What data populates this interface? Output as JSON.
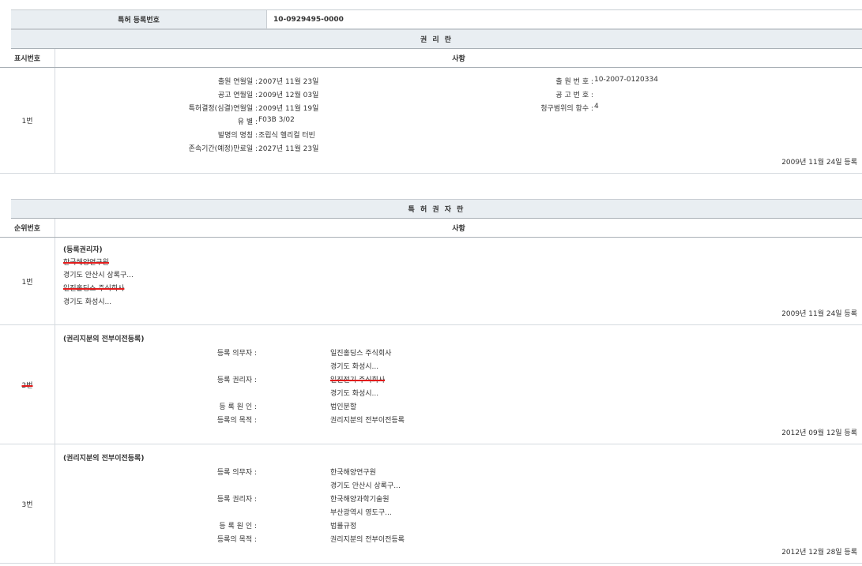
{
  "registration": {
    "label": "특허 등록번호",
    "value": "10-0929495-0000"
  },
  "rights_section": {
    "title": "권 리 란",
    "col_no": "표시번호",
    "col_content": "사항",
    "rows": [
      {
        "no": "1번",
        "left_fields": [
          {
            "label": "출원 연월일",
            "value": "2007년 11월 23일"
          },
          {
            "label": "공고 연월일",
            "value": "2009년 12월 03일"
          },
          {
            "label": "특허결정(심결)연월일",
            "value": "2009년 11월 19일"
          },
          {
            "label": "유 별",
            "value": "F03B 3/02"
          },
          {
            "label": "발명의 명칭",
            "value": "조립식 헬리컬 터빈"
          },
          {
            "label": "존속기간(예정)만료일",
            "value": "2027년 11월 23일"
          }
        ],
        "right_fields": [
          {
            "label": "출 원 번 호",
            "value": "10-2007-0120334"
          },
          {
            "label": "공 고 번 호",
            "value": ""
          },
          {
            "label": "청구범위의 항수",
            "value": "4"
          }
        ],
        "date": "2009년 11월 24일 등록"
      }
    ]
  },
  "holders_section": {
    "title": "특 허 권 자 란",
    "col_no": "순위번호",
    "col_content": "사항",
    "row1": {
      "no": "1번",
      "title": "(등록권리자)",
      "lines": [
        "한국해양연구원",
        "경기도 안산시 상록구...",
        "일진홀딩스 주식회사",
        "경기도 화성시..."
      ],
      "date": "2009년 11월 24일 등록"
    },
    "row2": {
      "no": "2번",
      "title": "(권리지분의 전부이전등록)",
      "fields": [
        {
          "label": "등록 의무자",
          "value": "일진홀딩스 주식회사"
        },
        {
          "label": "",
          "value": "경기도 화성시..."
        },
        {
          "label": "등록 권리자",
          "value": "일진전기 주식회사"
        },
        {
          "label": "",
          "value": "경기도 화성시..."
        },
        {
          "label": "등 록 원 인",
          "value": "법인분할"
        },
        {
          "label": "등록의 목적",
          "value": "권리지분의 전부이전등록"
        }
      ],
      "date": "2012년 09월 12일 등록"
    },
    "row3": {
      "no": "3번",
      "title": "(권리지분의 전부이전등록)",
      "fields": [
        {
          "label": "등록 의무자",
          "value": "한국해양연구원"
        },
        {
          "label": "",
          "value": "경기도 안산시 상록구..."
        },
        {
          "label": "등록 권리자",
          "value": "한국해양과학기술원"
        },
        {
          "label": "",
          "value": "부산광역시 영도구..."
        },
        {
          "label": "등 록 원 인",
          "value": "법률규정"
        },
        {
          "label": "등록의 목적",
          "value": "권리지분의 전부이전등록"
        }
      ],
      "date": "2012년 12월 28일 등록"
    }
  }
}
